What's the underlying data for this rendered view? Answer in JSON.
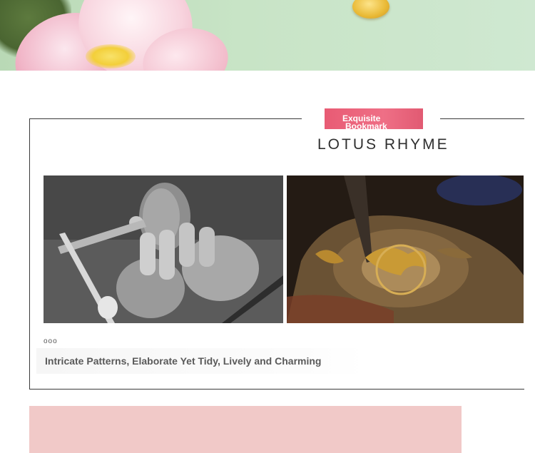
{
  "hero": {
    "icon": "lotus-flower-image"
  },
  "section": {
    "tag_line1": "Exquisite",
    "tag_line2": "Bookmark",
    "title": "LOTUS RHYME"
  },
  "photos": [
    {
      "icon": "grinding-craft-photo"
    },
    {
      "icon": "gold-engraving-photo"
    }
  ],
  "dots": "ooo",
  "caption": "Intricate Patterns, Elaborate Yet Tidy, Lively and Charming",
  "colors": {
    "accent": "#e85b74",
    "hero_bg": "#c8e4c6",
    "pink_block": "#f1c9c8",
    "frame": "#3a3a3a"
  }
}
